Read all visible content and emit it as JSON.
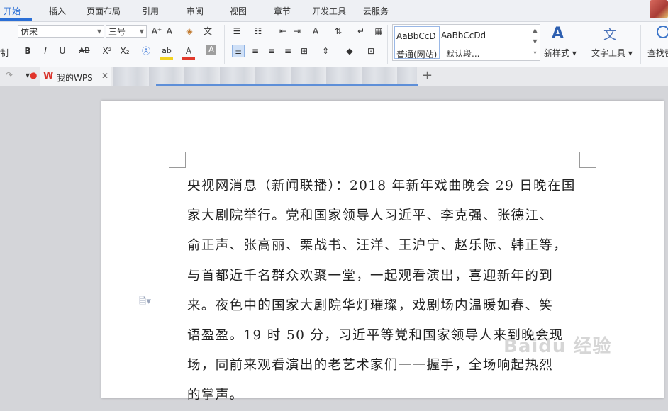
{
  "menubar": {
    "tabs": [
      "开始",
      "插入",
      "页面布局",
      "引用",
      "审阅",
      "视图",
      "章节",
      "开发工具",
      "云服务"
    ],
    "active_index": 0
  },
  "ribbon": {
    "clipboard_label": "制",
    "font_name": "仿宋",
    "font_size": "三号",
    "grow_font": "A⁺",
    "shrink_font": "A⁻",
    "bold": "B",
    "italic": "I",
    "underline": "U",
    "strike": "AB",
    "superscript": "X²",
    "subscript": "X₂",
    "font_color_letter": "A",
    "char_shading_letter": "A",
    "highlight_letter": "ab",
    "styles": [
      {
        "sample": "AaBbCcD",
        "name": "普通(网站)"
      },
      {
        "sample": "AaBbCcDd",
        "name": "默认段..."
      }
    ],
    "new_style_label": "新样式",
    "text_tools_label": "文字工具",
    "find_replace_label": "查找替"
  },
  "tabs": {
    "doc_tab_label": "我的WPS",
    "new_tab": "+"
  },
  "document": {
    "lines": [
      "央视网消息（新闻联播）：2018 年新年戏曲晚会 29 日晚在国",
      "家大剧院举行。党和国家领导人习近平、李克强、张德江、",
      "俞正声、张高丽、栗战书、汪洋、王沪宁、赵乐际、韩正等，",
      "与首都近千名群众欢聚一堂，一起观看演出，喜迎新年的到",
      "来。夜色中的国家大剧院华灯璀璨，戏剧场内温暖如春、笑",
      "语盈盈。19 时 50 分，习近平等党和国家领导人来到晚会现",
      "场，同前来观看演出的老艺术家们一一握手，全场响起热烈",
      "的掌声。"
    ]
  },
  "watermark": "Baidu 经验"
}
